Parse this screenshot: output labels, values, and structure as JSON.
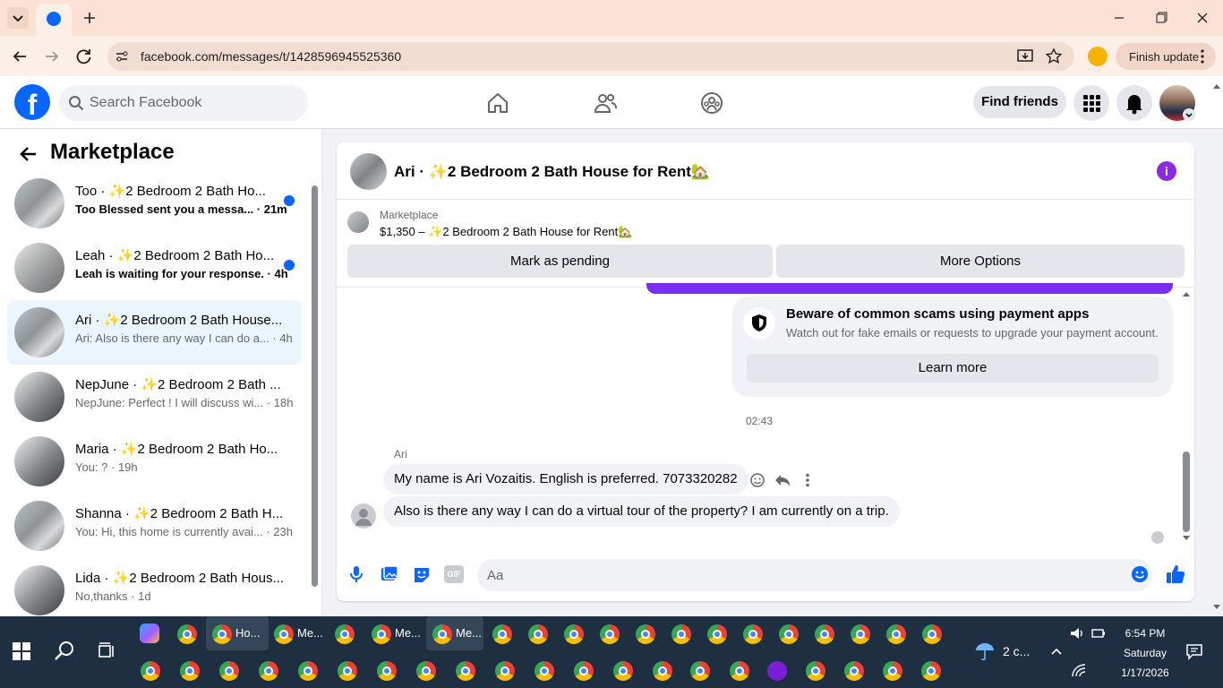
{
  "browser": {
    "url": "facebook.com/messages/t/1428596945525360",
    "finish_update": "Finish update"
  },
  "topbar": {
    "logo_letter": "f",
    "search_placeholder": "Search Facebook",
    "find_friends": "Find friends"
  },
  "sidebar": {
    "title": "Marketplace",
    "conversations": [
      {
        "name": "Too · ✨2 Bedroom 2 Bath Ho...",
        "preview": "Too Blessed sent you a messa... · 21m",
        "unread": true
      },
      {
        "name": "Leah · ✨2 Bedroom 2 Bath Ho...",
        "preview": "Leah is waiting for your response. · 4h",
        "unread": true
      },
      {
        "name": "Ari · ✨2 Bedroom 2 Bath House...",
        "preview": "Ari: Also is there any way I can do a... · 4h",
        "unread": false
      },
      {
        "name": "NepJune · ✨2 Bedroom 2 Bath ...",
        "preview": "NepJune: Perfect ! I will discuss wi... · 18h",
        "unread": false
      },
      {
        "name": "Maria · ✨2 Bedroom 2 Bath Ho...",
        "preview": "You: ? · 19h",
        "unread": false
      },
      {
        "name": "Shanna · ✨2 Bedroom 2 Bath H...",
        "preview": "You: Hi, this home is currently avai... · 23h",
        "unread": false
      },
      {
        "name": "Lida · ✨2 Bedroom 2 Bath Hous...",
        "preview": "No,thanks · 1d",
        "unread": false
      }
    ]
  },
  "chat": {
    "title": "Ari · ✨2 Bedroom 2 Bath House for Rent🏡",
    "listing_source": "Marketplace",
    "listing_price": "$1,350 – ✨2 Bedroom 2 Bath House for Rent🏡",
    "mark_pending": "Mark as pending",
    "more_options": "More Options",
    "scam_title": "Beware of common scams using payment apps",
    "scam_subtitle": "Watch out for fake emails or requests to upgrade your payment account.",
    "learn_more": "Learn more",
    "timestamp": "02:43",
    "sender": "Ari",
    "messages": [
      "My name is Ari Vozaitis. English is preferred. 7073320282",
      "Also is there any way I can do a virtual tour of the property? I am currently on a trip."
    ],
    "composer_placeholder": "Aa"
  },
  "taskbar": {
    "labels": [
      "Ho...",
      "Me...",
      "Me...",
      "Me..."
    ],
    "weather": "2 c...",
    "time": "6:54 PM",
    "day": "Saturday",
    "date": "1/17/2026"
  },
  "colors": {
    "fb_blue": "#0866ff",
    "purple": "#7b2cf5",
    "taskbar": "#1e2f41"
  }
}
